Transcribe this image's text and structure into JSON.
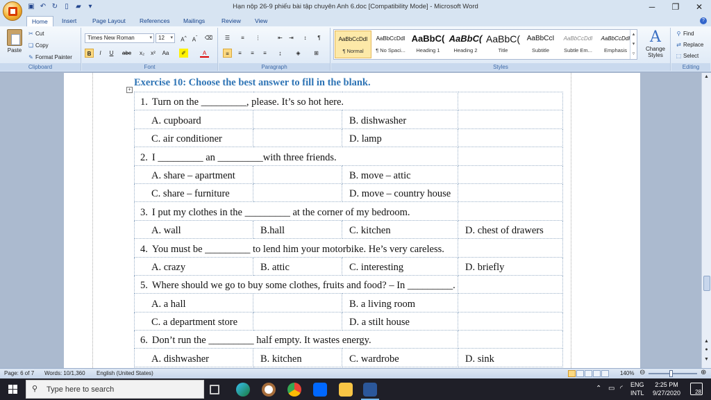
{
  "window": {
    "title": "Hạn nộp 26-9 phiếu bài tập chuyên Anh 6.doc [Compatibility Mode] - Microsoft Word"
  },
  "ribbon_tabs": [
    "Home",
    "Insert",
    "Page Layout",
    "References",
    "Mailings",
    "Review",
    "View"
  ],
  "ribbon": {
    "clipboard": {
      "paste": "Paste",
      "cut": "Cut",
      "copy": "Copy",
      "format_painter": "Format Painter",
      "label": "Clipboard"
    },
    "font": {
      "family": "Times New Roman",
      "size": "12",
      "label": "Font"
    },
    "paragraph": {
      "label": "Paragraph"
    },
    "styles": {
      "label": "Styles",
      "items": [
        {
          "sample": "AaBbCcDdI",
          "name": "¶ Normal"
        },
        {
          "sample": "AaBbCcDdI",
          "name": "¶ No Spaci..."
        },
        {
          "sample": "AaBbC(",
          "name": "Heading 1"
        },
        {
          "sample": "AaBbC(",
          "name": "Heading 2"
        },
        {
          "sample": "AaBbC(",
          "name": "Title"
        },
        {
          "sample": "AaBbCcI",
          "name": "Subtitle"
        },
        {
          "sample": "AaBbCcDdI",
          "name": "Subtle Em..."
        },
        {
          "sample": "AaBbCcDdI",
          "name": "Emphasis"
        }
      ],
      "change_styles": "Change Styles"
    },
    "editing": {
      "find": "Find",
      "replace": "Replace",
      "select": "Select",
      "label": "Editing"
    }
  },
  "document": {
    "exercise_title": "Exercise 10: Choose the best answer to fill in the blank.",
    "rows": [
      {
        "type": "q",
        "num": "1.",
        "text": "Turn on the _________, please. It’s so hot here."
      },
      {
        "type": "opt",
        "cells": [
          "A. cupboard",
          "",
          "B. dishwasher",
          ""
        ]
      },
      {
        "type": "opt",
        "cells": [
          "C. air conditioner",
          "",
          "D. lamp",
          ""
        ]
      },
      {
        "type": "q",
        "num": "2.",
        "text": "I _________ an _________with three friends."
      },
      {
        "type": "opt",
        "cells": [
          "A. share – apartment",
          "",
          "B. move – attic",
          ""
        ]
      },
      {
        "type": "opt",
        "cells": [
          "C. share – furniture",
          "",
          "D. move – country house",
          ""
        ]
      },
      {
        "type": "q",
        "num": "3.",
        "text": "I put my clothes in the _________ at the corner of my bedroom."
      },
      {
        "type": "opt",
        "cells": [
          "A. wall",
          "B.hall",
          "C. kitchen",
          "D. chest of drawers"
        ]
      },
      {
        "type": "q",
        "num": "4.",
        "text": "You must be _________ to lend him your motorbike. He’s very careless."
      },
      {
        "type": "opt",
        "cells": [
          "A. crazy",
          "B. attic",
          "C. interesting",
          "D. briefly"
        ]
      },
      {
        "type": "q",
        "num": "5.",
        "text": "Where should we go to buy some clothes, fruits and food? – In _________."
      },
      {
        "type": "opt",
        "cells": [
          "A. a hall",
          "",
          "B. a living room",
          ""
        ]
      },
      {
        "type": "opt",
        "cells": [
          "C. a department store",
          "",
          "D. a stilt house",
          ""
        ]
      },
      {
        "type": "q",
        "num": "6.",
        "text": "Don’t run the _________ half empty. It wastes energy."
      },
      {
        "type": "opt",
        "cells": [
          "A. dishwasher",
          "B. kitchen",
          "C. wardrobe",
          "D. sink"
        ]
      }
    ]
  },
  "statusbar": {
    "page": "Page: 6 of 7",
    "words": "Words: 10/1,360",
    "language": "English (United States)",
    "zoom": "140%"
  },
  "taskbar": {
    "search_placeholder": "Type here to search",
    "lang_top": "ENG",
    "lang_bottom": "INTL",
    "time": "2:25 PM",
    "date": "9/27/2020",
    "notifications": "28"
  }
}
